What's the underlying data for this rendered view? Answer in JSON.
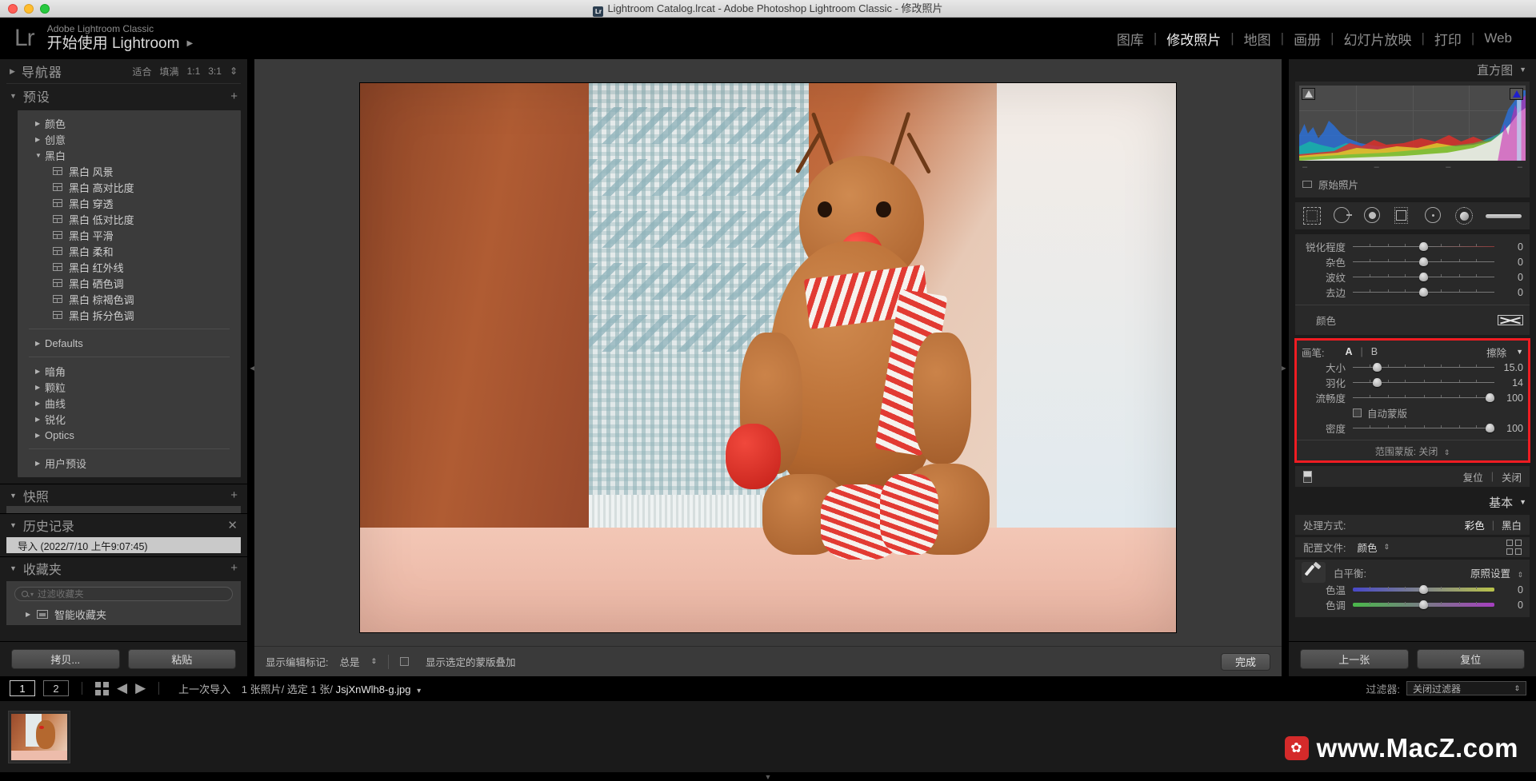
{
  "window": {
    "title": "Lightroom Catalog.lrcat - Adobe Photoshop Lightroom Classic - 修改照片",
    "app_icon": "Lr"
  },
  "identity": {
    "logo": "Lr",
    "sub": "Adobe Lightroom Classic",
    "main": "开始使用 Lightroom",
    "caret": "▶"
  },
  "modules": [
    {
      "label": "图库",
      "active": false
    },
    {
      "label": "修改照片",
      "active": true
    },
    {
      "label": "地图",
      "active": false
    },
    {
      "label": "画册",
      "active": false
    },
    {
      "label": "幻灯片放映",
      "active": false
    },
    {
      "label": "打印",
      "active": false
    },
    {
      "label": "Web",
      "active": false
    }
  ],
  "left_panel": {
    "navigator": {
      "title": "导航器",
      "zoom_options": [
        "适合",
        "填满",
        "1:1",
        "3:1"
      ],
      "caret": "▶"
    },
    "presets": {
      "title": "预设",
      "caret": "▼",
      "add_label": "+",
      "groups": [
        {
          "label": "颜色",
          "expanded": false,
          "caret": "▶",
          "items": []
        },
        {
          "label": "创意",
          "expanded": false,
          "caret": "▶",
          "items": []
        },
        {
          "label": "黑白",
          "expanded": true,
          "caret": "▼",
          "items": [
            "黑白 风景",
            "黑白 高对比度",
            "黑白 穿透",
            "黑白 低对比度",
            "黑白 平滑",
            "黑白 柔和",
            "黑白 红外线",
            "黑白 硒色调",
            "黑白 棕褐色调",
            "黑白 拆分色调"
          ]
        }
      ],
      "group2": [
        {
          "label": "Defaults",
          "caret": "▶"
        }
      ],
      "group3": [
        {
          "label": "暗角",
          "caret": "▶"
        },
        {
          "label": "颗粒",
          "caret": "▶"
        },
        {
          "label": "曲线",
          "caret": "▶"
        },
        {
          "label": "锐化",
          "caret": "▶"
        },
        {
          "label": "Optics",
          "caret": "▶"
        }
      ],
      "group4": [
        {
          "label": "用户预设",
          "caret": "▶"
        }
      ]
    },
    "snapshots": {
      "title": "快照",
      "caret": "▼",
      "add_label": "+"
    },
    "history": {
      "title": "历史记录",
      "caret": "▼",
      "clear_label": "✕",
      "items": [
        "导入 (2022/7/10 上午9:07:45)"
      ]
    },
    "collections": {
      "title": "收藏夹",
      "caret": "▼",
      "add_label": "+",
      "filter_placeholder": "过滤收藏夹",
      "items": [
        {
          "label": "智能收藏夹",
          "caret": "▶"
        }
      ]
    },
    "footer": {
      "copy": "拷贝...",
      "paste": "粘贴"
    }
  },
  "toolbar": {
    "edit_marks_label": "显示编辑标记:",
    "edit_marks_value": "总是",
    "mask_overlay_label": "显示选定的蒙版叠加",
    "mask_overlay_checked": false,
    "done_label": "完成"
  },
  "right_panel": {
    "histogram": {
      "title": "直方图",
      "caret": "▼",
      "original_label": "原始照片"
    },
    "tools": [
      "crop-tool",
      "heal-tool",
      "redeye-tool",
      "graduated-filter-tool",
      "radial-filter-tool",
      "adjustment-brush-tool"
    ],
    "detail_sliders": [
      {
        "label": "锐化程度",
        "value": "0",
        "pos": 50
      },
      {
        "label": "杂色",
        "value": "0",
        "pos": 50
      },
      {
        "label": "波纹",
        "value": "0",
        "pos": 50
      },
      {
        "label": "去边",
        "value": "0",
        "pos": 50
      }
    ],
    "color_row": {
      "label": "颜色"
    },
    "brush": {
      "label": "画笔:",
      "a_label": "A",
      "b_label": "B",
      "erase_label": "擦除",
      "caret": "▼",
      "sliders": [
        {
          "label": "大小",
          "value": "15.0",
          "pos": 17
        },
        {
          "label": "羽化",
          "value": "14",
          "pos": 17
        },
        {
          "label": "流畅度",
          "value": "100",
          "pos": 97
        }
      ],
      "auto_mask_label": "自动蒙版",
      "auto_mask_checked": false,
      "density": {
        "label": "密度",
        "value": "100",
        "pos": 97
      },
      "range_mask_label": "范围蒙版: 关闭",
      "highlight_color": "#ef1c22"
    },
    "panel_switch": {
      "reset": "复位",
      "close": "关闭"
    },
    "basic": {
      "title": "基本",
      "caret": "▼",
      "treatment_label": "处理方式:",
      "treatment_color": "彩色",
      "treatment_bw": "黑白",
      "profile_label": "配置文件:",
      "profile_value": "颜色",
      "wb_label": "白平衡:",
      "wb_value": "原照设置",
      "sliders": [
        {
          "label": "色温",
          "value": "0",
          "pos": 50
        },
        {
          "label": "色调",
          "value": "0",
          "pos": 50
        }
      ]
    },
    "footer": {
      "previous": "上一张",
      "reset": "复位"
    }
  },
  "filmstrip_bar": {
    "screen1": "1",
    "screen2": "2",
    "grid_icon": "grid-view-icon",
    "back_icon": "◀",
    "forward_icon": "▶",
    "source": "上一次导入",
    "count": "1 张照片/",
    "selected": "选定 1 张/",
    "filename": "JsjXnWlh8-g.jpg",
    "caret": "▾",
    "filter_label": "过滤器:",
    "filter_value": "关闭过滤器"
  },
  "watermark": {
    "badge": "✿",
    "text": "www.MacZ.com"
  }
}
